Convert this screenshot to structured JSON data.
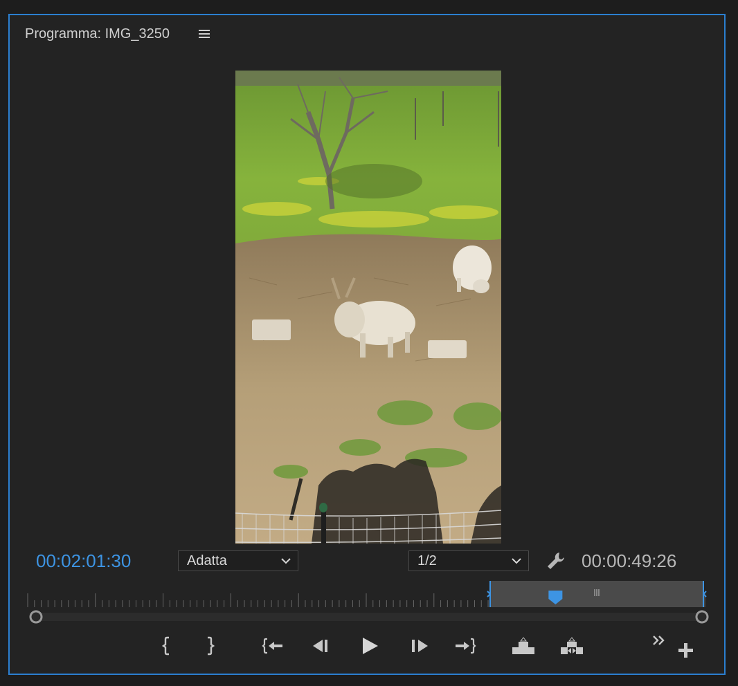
{
  "panel": {
    "title": "Programma: IMG_3250",
    "menu_icon": "hamburger-menu-icon"
  },
  "playback": {
    "current_timecode": "00:02:01:30",
    "duration_timecode": "00:00:49:26",
    "zoom": {
      "selected": "Adatta"
    },
    "resolution": {
      "selected": "1/2"
    },
    "playhead_fraction": 0.78
  },
  "colors": {
    "accent": "#3d94e3",
    "panel_border": "#2b7fd0",
    "panel_bg": "#232323"
  },
  "controls": {
    "icons": [
      "mark-in-icon",
      "mark-out-icon",
      "go-to-in-icon",
      "step-back-icon",
      "play-icon",
      "step-forward-icon",
      "go-to-out-icon",
      "lift-icon",
      "extract-icon",
      "more-controls-icon",
      "add-button-icon"
    ]
  }
}
